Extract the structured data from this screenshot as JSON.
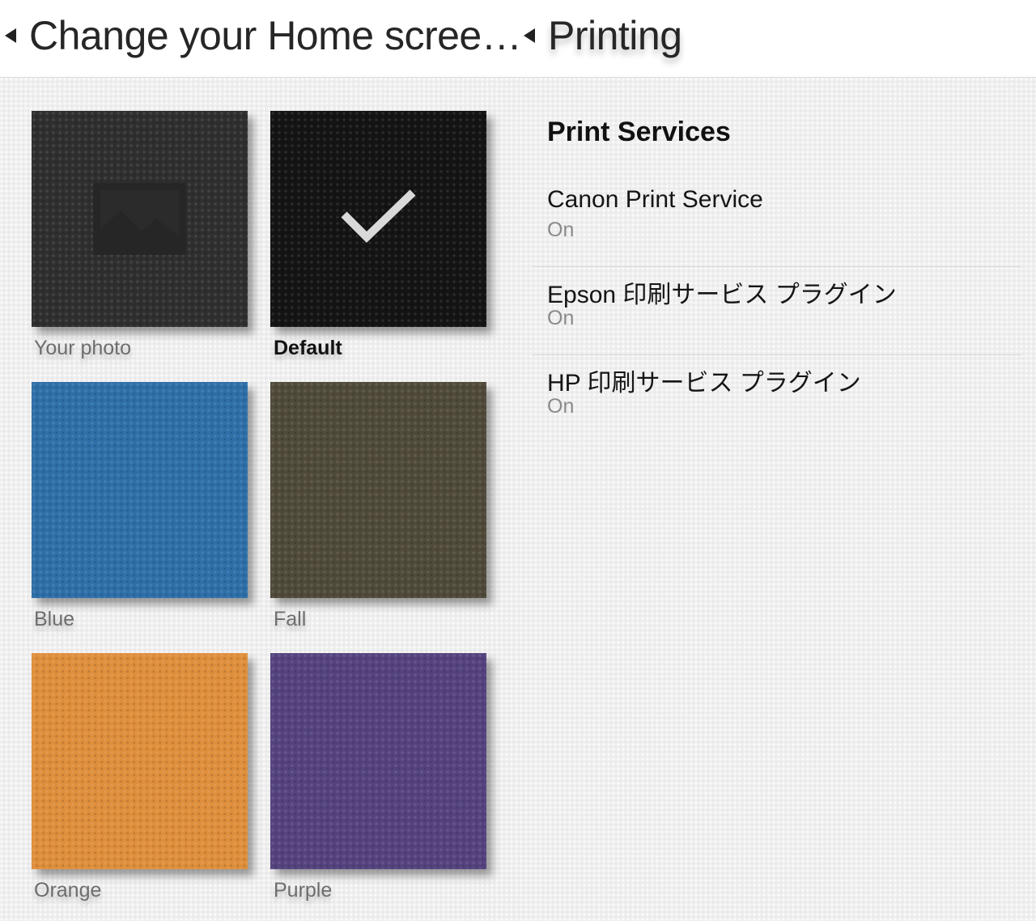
{
  "header": {
    "back_title_left": "Change your Home scree…",
    "back_title_right": "Printing"
  },
  "wallpapers": [
    {
      "label": "Your photo",
      "color": "#2f2f2f",
      "icon": "image-placeholder-icon",
      "selected": false
    },
    {
      "label": "Default",
      "color": "#141414",
      "icon": "checkmark-icon",
      "selected": true
    },
    {
      "label": "Blue",
      "color": "#2e6fa8",
      "selected": false
    },
    {
      "label": "Fall",
      "color": "#4f4a39",
      "selected": false
    },
    {
      "label": "Orange",
      "color": "#df8f3c",
      "selected": false
    },
    {
      "label": "Purple",
      "color": "#55437f",
      "selected": false
    }
  ],
  "print_services": {
    "title": "Print Services",
    "items": [
      {
        "name": "Canon Print Service",
        "status": "On"
      },
      {
        "name": "Epson 印刷サービス プラグイン",
        "status": "On"
      },
      {
        "name": "HP 印刷サービス プラグイン",
        "status": "On"
      }
    ]
  }
}
